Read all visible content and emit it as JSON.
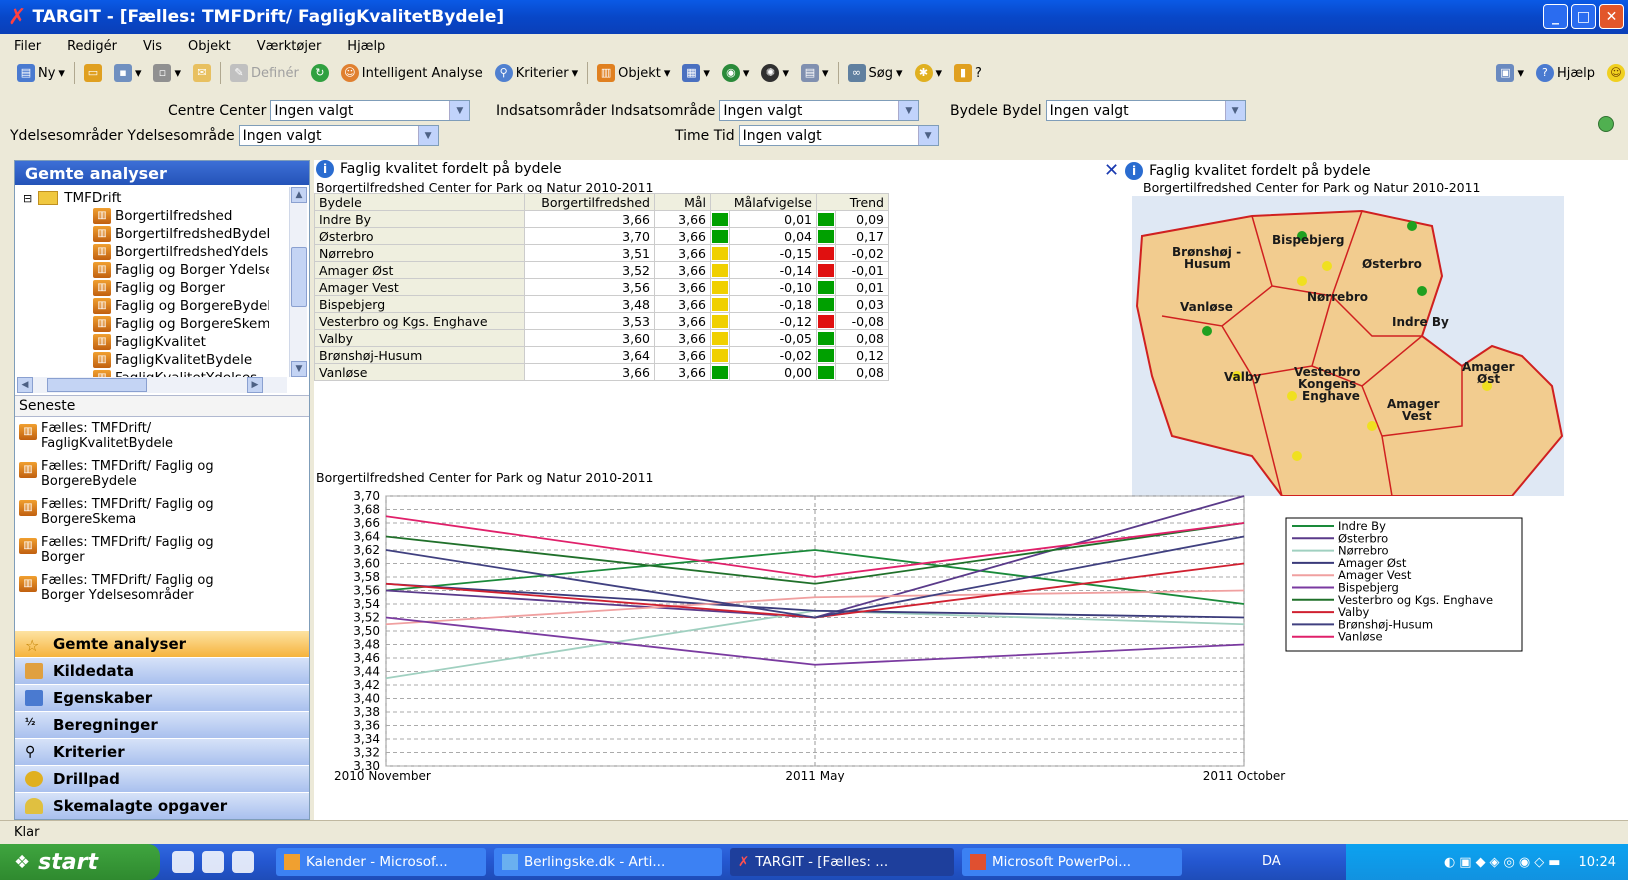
{
  "window": {
    "title": "TARGIT - [Fælles: TMFDrift/ FagligKvalitetBydele]"
  },
  "menu": [
    "Filer",
    "Redigér",
    "Vis",
    "Objekt",
    "Værktøjer",
    "Hjælp"
  ],
  "toolbar": {
    "new": "Ny",
    "define": "Definér",
    "intelligent": "Intelligent Analyse",
    "criteria": "Kriterier",
    "object": "Objekt",
    "search": "Søg",
    "help": "Hjælp"
  },
  "filters": {
    "centre_label": "Centre Center",
    "centre_value": "Ingen valgt",
    "indsats_label": "Indsatsområder Indsatsområde",
    "indsats_value": "Ingen valgt",
    "bydele_label": "Bydele Bydel",
    "bydele_value": "Ingen valgt",
    "ydelse_label": "Ydelsesområder Ydelsesområde",
    "ydelse_value": "Ingen valgt",
    "time_label": "Time Tid",
    "time_value": "Ingen valgt"
  },
  "sidebar": {
    "header": "Gemte analyser",
    "folder": "TMFDrift",
    "items": [
      "Borgertilfredshed",
      "BorgertilfredshedBydele",
      "BorgertilfredshedYdelse",
      "Faglig og  Borger Ydelse",
      "Faglig og Borger",
      "Faglig og BorgereBydele",
      "Faglig og BorgereSkema",
      "FagligKvalitet",
      "FagligKvalitetBydele",
      "FagligKvalitetYdelses"
    ],
    "recent_header": "Seneste",
    "recent": [
      {
        "line1": "Fælles: TMFDrift/",
        "line2": "FagligKvalitetBydele"
      },
      {
        "line1": "Fælles: TMFDrift/ Faglig og",
        "line2": "BorgereBydele"
      },
      {
        "line1": "Fælles: TMFDrift/ Faglig og",
        "line2": "BorgereSkema"
      },
      {
        "line1": "Fælles: TMFDrift/ Faglig og",
        "line2": "Borger"
      },
      {
        "line1": "Fælles: TMFDrift/ Faglig og",
        "line2": "Borger Ydelsesområder"
      }
    ],
    "nav": [
      "Gemte analyser",
      "Kildedata",
      "Egenskaber",
      "Beregninger",
      "Kriterier",
      "Drillpad",
      "Skemalagte opgaver"
    ]
  },
  "panel_table": {
    "title": "Faglig kvalitet fordelt på bydele",
    "caption": "Borgertilfredshed Center for Park og Natur 2010-2011",
    "headers": [
      "Bydele",
      "Borgertilfredshed",
      "Mål",
      "Målafvigelse",
      "Trend"
    ],
    "rows": [
      {
        "name": "Indre By",
        "value": "3,66",
        "goal": "3,66",
        "dev": "0,01",
        "dev_color": "#00a000",
        "trend": "0,09",
        "trend_color": "#00a000"
      },
      {
        "name": "Østerbro",
        "value": "3,70",
        "goal": "3,66",
        "dev": "0,04",
        "dev_color": "#00a000",
        "trend": "0,17",
        "trend_color": "#00a000"
      },
      {
        "name": "Nørrebro",
        "value": "3,51",
        "goal": "3,66",
        "dev": "-0,15",
        "dev_color": "#f0d000",
        "trend": "-0,02",
        "trend_color": "#e01010"
      },
      {
        "name": "Amager Øst",
        "value": "3,52",
        "goal": "3,66",
        "dev": "-0,14",
        "dev_color": "#f0d000",
        "trend": "-0,01",
        "trend_color": "#e01010"
      },
      {
        "name": "Amager Vest",
        "value": "3,56",
        "goal": "3,66",
        "dev": "-0,10",
        "dev_color": "#f0d000",
        "trend": "0,01",
        "trend_color": "#00a000"
      },
      {
        "name": "Bispebjerg",
        "value": "3,48",
        "goal": "3,66",
        "dev": "-0,18",
        "dev_color": "#f0d000",
        "trend": "0,03",
        "trend_color": "#00a000"
      },
      {
        "name": "Vesterbro og Kgs. Enghave",
        "value": "3,53",
        "goal": "3,66",
        "dev": "-0,12",
        "dev_color": "#f0d000",
        "trend": "-0,08",
        "trend_color": "#e01010"
      },
      {
        "name": "Valby",
        "value": "3,60",
        "goal": "3,66",
        "dev": "-0,05",
        "dev_color": "#f0d000",
        "trend": "0,08",
        "trend_color": "#00a000"
      },
      {
        "name": "Brønshøj-Husum",
        "value": "3,64",
        "goal": "3,66",
        "dev": "-0,02",
        "dev_color": "#f0d000",
        "trend": "0,12",
        "trend_color": "#00a000"
      },
      {
        "name": "Vanløse",
        "value": "3,66",
        "goal": "3,66",
        "dev": "0,00",
        "dev_color": "#00a000",
        "trend": "0,08",
        "trend_color": "#00a000"
      }
    ]
  },
  "panel_map": {
    "title": "Faglig kvalitet fordelt på bydele",
    "caption": "Borgertilfredshed Center for Park og Natur 2010-2011",
    "labels": [
      "Brønshøj -",
      "Husum",
      "Bispebjerg",
      "Østerbro",
      "Nørrebro",
      "Vanløse",
      "Indre By",
      "Valby",
      "Vesterbro",
      "Kongens",
      "Enghave",
      "Amager",
      "Øst",
      "Amager",
      "Vest"
    ]
  },
  "chart_data": {
    "type": "line",
    "title": "Borgertilfredshed Center for Park og Natur 2010-2011",
    "x": [
      "2010 November",
      "2011 May",
      "2011 October"
    ],
    "ylim": [
      3.3,
      3.7
    ],
    "yticks": [
      "3,30",
      "3,32",
      "3,34",
      "3,36",
      "3,38",
      "3,40",
      "3,42",
      "3,44",
      "3,46",
      "3,48",
      "3,50",
      "3,52",
      "3,54",
      "3,56",
      "3,58",
      "3,60",
      "3,62",
      "3,64",
      "3,66",
      "3,68",
      "3,70"
    ],
    "grid": true,
    "legend_position": "right",
    "series": [
      {
        "name": "Indre By",
        "color": "#1a8a3a",
        "values": [
          3.56,
          3.62,
          3.54
        ]
      },
      {
        "name": "Østerbro",
        "color": "#5a3a8a",
        "values": [
          3.56,
          3.52,
          3.7
        ]
      },
      {
        "name": "Nørrebro",
        "color": "#a0d0c0",
        "values": [
          3.43,
          3.53,
          3.51
        ]
      },
      {
        "name": "Amager Øst",
        "color": "#3a3a7a",
        "values": [
          3.57,
          3.53,
          3.52
        ]
      },
      {
        "name": "Amager Vest",
        "color": "#f0a0a0",
        "values": [
          3.51,
          3.55,
          3.56
        ]
      },
      {
        "name": "Bispebjerg",
        "color": "#7a3aa0",
        "values": [
          3.52,
          3.45,
          3.48
        ]
      },
      {
        "name": "Vesterbro og Kgs. Enghave",
        "color": "#20702a",
        "values": [
          3.64,
          3.57,
          3.66
        ]
      },
      {
        "name": "Valby",
        "color": "#d02030",
        "values": [
          3.57,
          3.52,
          3.6
        ]
      },
      {
        "name": "Brønshøj-Husum",
        "color": "#404080",
        "values": [
          3.62,
          3.52,
          3.64
        ]
      },
      {
        "name": "Vanløse",
        "color": "#e0206a",
        "values": [
          3.67,
          3.58,
          3.66
        ]
      }
    ]
  },
  "status": "Klar",
  "taskbar": {
    "start": "start",
    "tasks": [
      "Kalender - Microsof...",
      "Berlingske.dk - Arti...",
      "TARGIT - [Fælles: ...",
      "Microsoft PowerPoi..."
    ],
    "lang": "DA",
    "clock": "10:24"
  }
}
